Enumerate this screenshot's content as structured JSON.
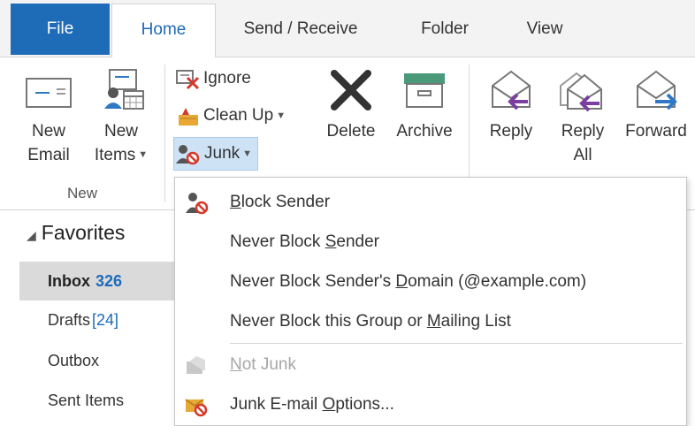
{
  "tabs": {
    "file": "File",
    "home": "Home",
    "send_receive": "Send / Receive",
    "folder": "Folder",
    "view": "View"
  },
  "ribbon": {
    "new_group": {
      "new_email_line1": "New",
      "new_email_line2": "Email",
      "new_items_line1": "New",
      "new_items_line2": "Items",
      "label": "New"
    },
    "delete_group": {
      "ignore": "Ignore",
      "clean_up": "Clean Up",
      "junk": "Junk",
      "delete": "Delete",
      "archive": "Archive"
    },
    "respond_group": {
      "reply": "Reply",
      "reply_all_line1": "Reply",
      "reply_all_line2": "All",
      "forward": "Forward"
    }
  },
  "nav": {
    "favorites": "Favorites",
    "items": [
      {
        "label": "Inbox",
        "count": "326"
      },
      {
        "label": "Drafts",
        "count": "[24]"
      },
      {
        "label": "Outbox"
      },
      {
        "label": "Sent Items"
      }
    ]
  },
  "junk_menu": {
    "items": [
      {
        "pre": "",
        "key": "B",
        "post": "lock Sender"
      },
      {
        "pre": "Never Block ",
        "key": "S",
        "post": "ender"
      },
      {
        "pre": "Never Block Sender's ",
        "key": "D",
        "post": "omain (@example.com)"
      },
      {
        "pre": "Never Block this Group or ",
        "key": "M",
        "post": "ailing List"
      },
      {
        "pre": "",
        "key": "N",
        "post": "ot Junk"
      },
      {
        "pre": "Junk E-mail ",
        "key": "O",
        "post": "ptions..."
      }
    ]
  },
  "colors": {
    "accent": "#1e6bb8",
    "pressed": "#cde3f5",
    "block_red": "#d33a2c",
    "arrow_purple": "#7a3fa0",
    "arrow_blue": "#2f78c4"
  }
}
